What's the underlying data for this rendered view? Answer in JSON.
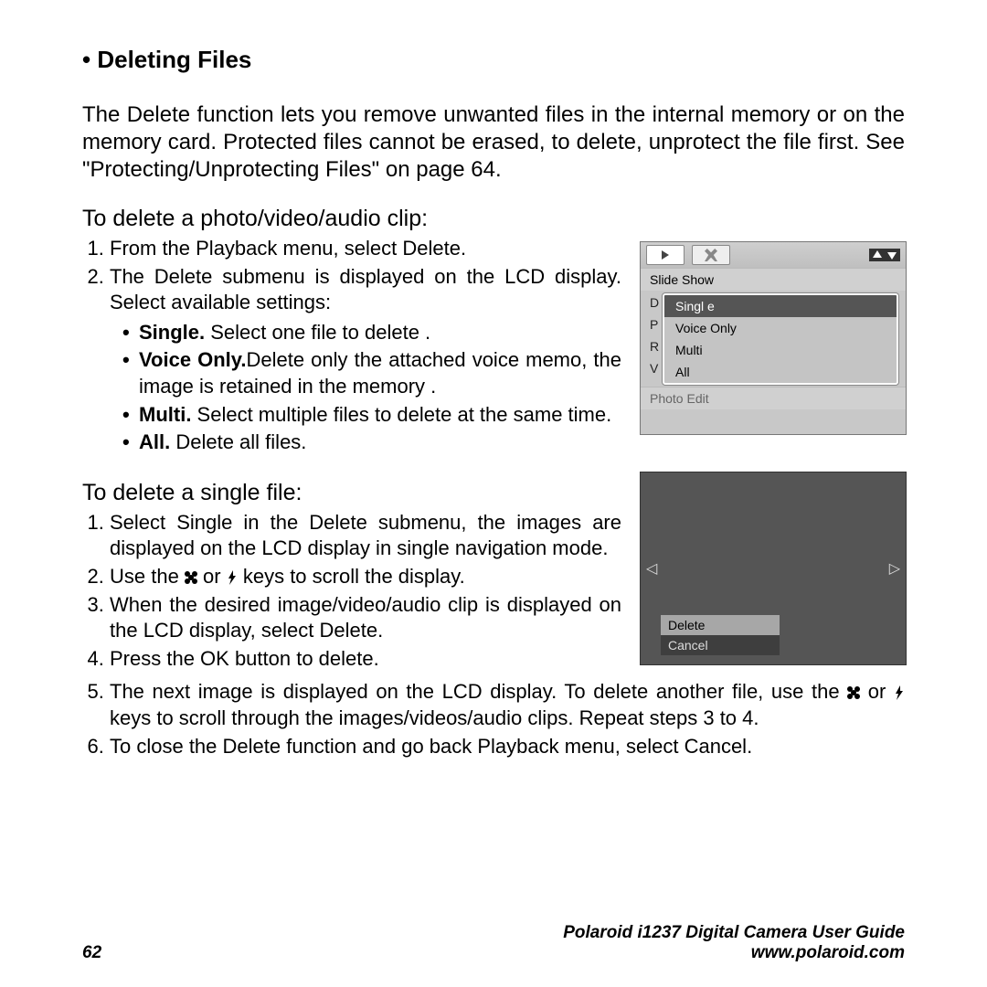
{
  "title": "Deleting Files",
  "intro": "The Delete function lets you remove unwanted files in the internal memory or on the memory card. Protected files cannot be erased, to delete, unprotect the file first. See \"Protecting/Unprotecting Files\" on page 64.",
  "proc1": {
    "heading": "To delete a photo/video/audio clip:",
    "step1": "From the Playback menu, select Delete.",
    "step2": "The Delete submenu is displayed on the LCD display. Select available settings:",
    "opts": {
      "single_b": "Single.",
      "single_t": " Select one file to delete .",
      "voice_b": "Voice Only.",
      "voice_t": "Delete only the attached voice memo, the image is retained in the memory .",
      "multi_b": "Multi.",
      "multi_t": " Select multiple files to delete at the same time.",
      "all_b": "All.",
      "all_t": " Delete all files."
    }
  },
  "proc2": {
    "heading": "To delete a single file:",
    "s1": "Select Single in the Delete submenu, the images are displayed on the LCD display in single navigation mode.",
    "s2a": "Use the ",
    "s2b": " or ",
    "s2c": "  keys to scroll the display.",
    "s3": "When the desired image/video/audio clip is displayed on the LCD display, select Delete.",
    "s4": "Press the OK button to delete.",
    "s5a": "The next image is displayed on the LCD display. To delete another file, use the ",
    "s5b": " or ",
    "s5c": " keys to scroll through the images/videos/audio clips. Repeat steps 3 to 4.",
    "s6": "To close the Delete function and go back Playback menu, select Cancel."
  },
  "lcd1": {
    "slide": "Slide Show",
    "photoedit": "Photo Edit",
    "peeks": {
      "d": "D",
      "p": "P",
      "r": "R",
      "v": "V"
    },
    "sub": {
      "single": "Singl e",
      "voice": "Voice Only",
      "multi": "Multi",
      "all": "All"
    }
  },
  "lcd2": {
    "delete": "Delete",
    "cancel": "Cancel"
  },
  "footer": {
    "page": "62",
    "guide": "Polaroid i1237 Digital Camera User Guide",
    "url": "www.polaroid.com"
  }
}
